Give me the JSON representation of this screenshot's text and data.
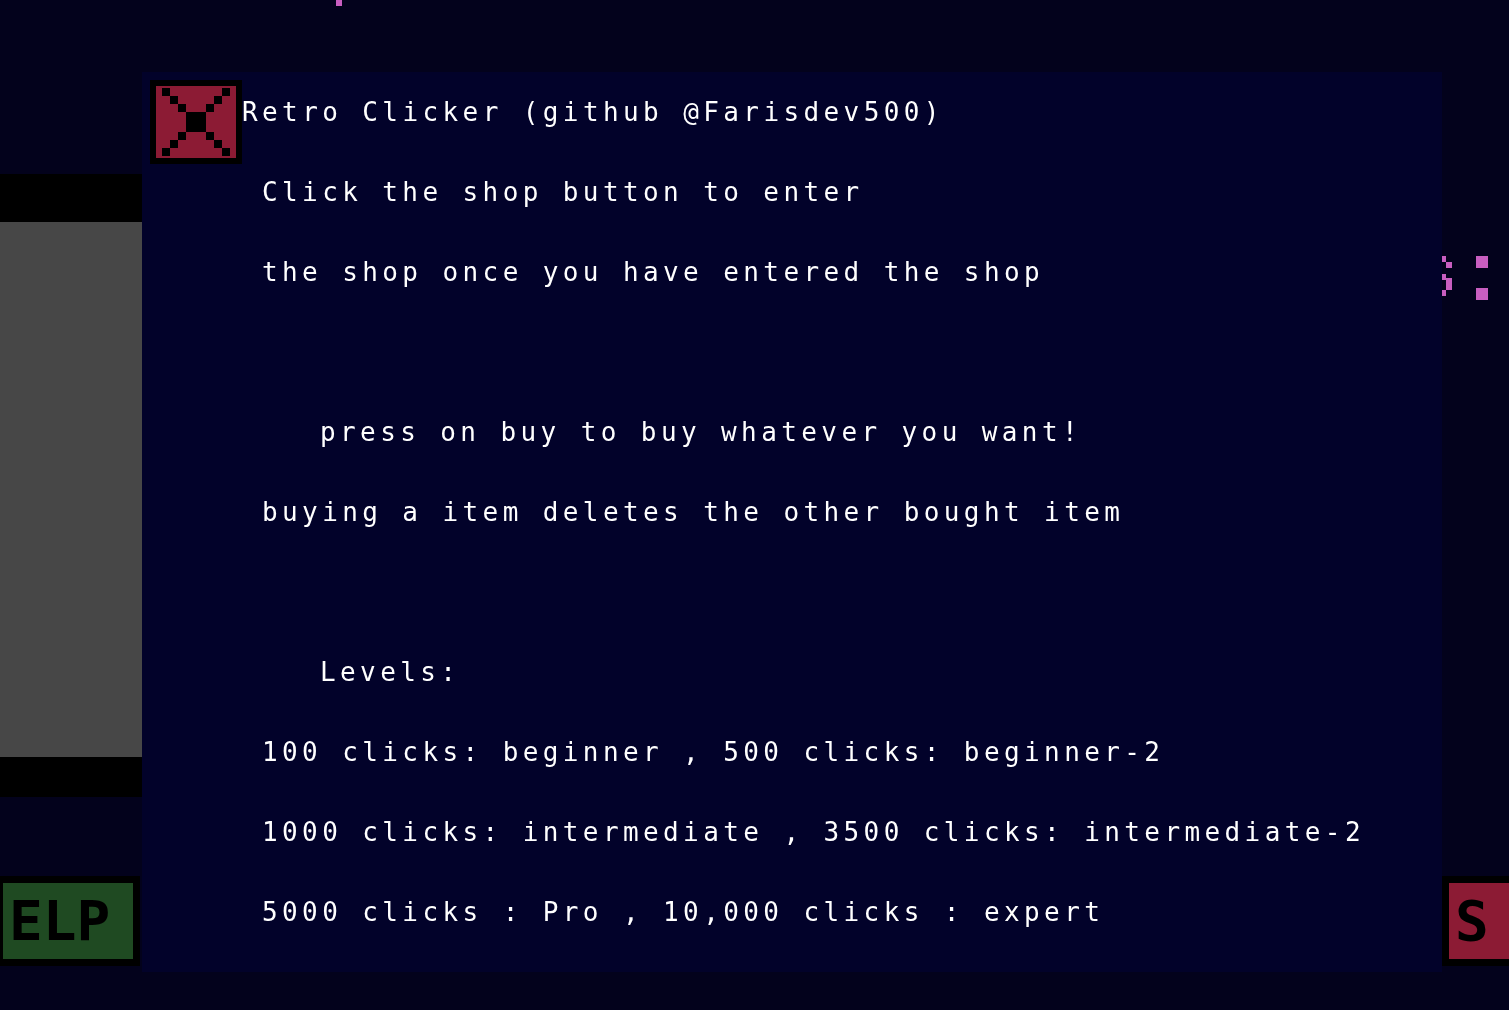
{
  "dialog": {
    "title": "Retro Clicker (github @Farisdev500)",
    "sections": [
      {
        "lines": [
          "Click the shop button to enter",
          "the shop once you have entered the shop"
        ]
      },
      {
        "heading": "press on buy to buy whatever you want!",
        "lines": [
          "buying a item deletes the other bought item"
        ]
      },
      {
        "heading": "Levels:",
        "lines": [
          "100 clicks: beginner , 500 clicks: beginner-2",
          "1000 clicks: intermediate , 3500 clicks: intermediate-2",
          "5000 clicks : Pro , 10,000 clicks : expert"
        ]
      }
    ]
  },
  "help_button": {
    "label": "ELP"
  },
  "shop_button": {
    "label": "S"
  }
}
